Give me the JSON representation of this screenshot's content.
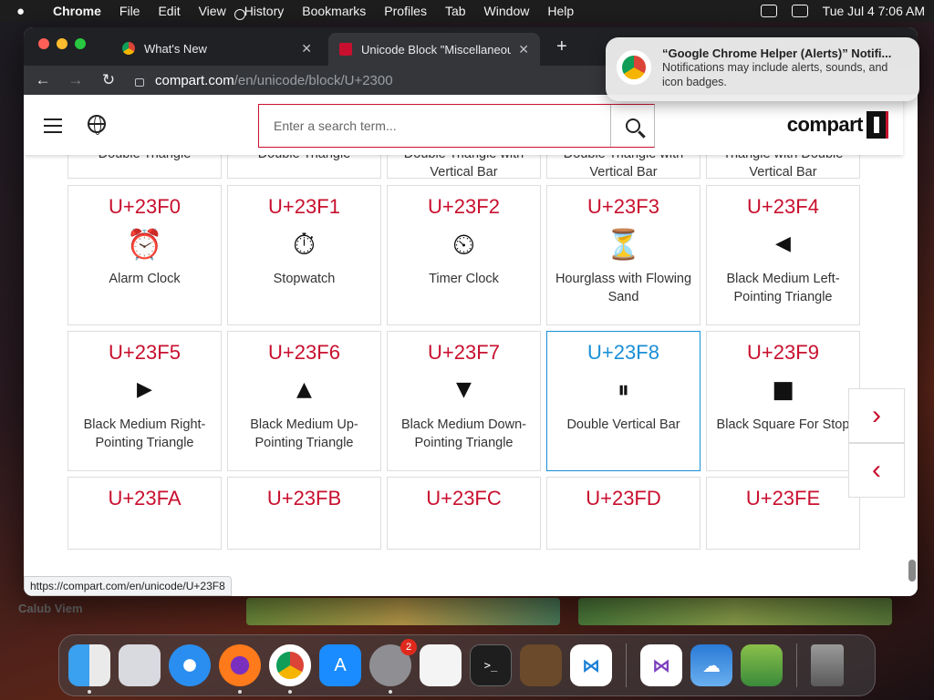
{
  "menubar": {
    "items": [
      "Chrome",
      "File",
      "Edit",
      "View",
      "History",
      "Bookmarks",
      "Profiles",
      "Tab",
      "Window",
      "Help"
    ],
    "datetime": "Tue Jul 4  7:06 AM"
  },
  "browser": {
    "tabs": [
      {
        "title": "What's New"
      },
      {
        "title": "Unicode Block \"Miscellaneous"
      }
    ],
    "url_host": "compart.com",
    "url_path": "/en/unicode/block/U+2300",
    "status_url": "https://compart.com/en/unicode/U+23F8"
  },
  "notification": {
    "title": "“Google Chrome Helper (Alerts)” Notifi...",
    "body": "Notifications may include alerts, sounds, and icon badges."
  },
  "site": {
    "search_placeholder": "Enter a search term...",
    "logo": "compart"
  },
  "partial_row": [
    {
      "name": "Black Up-Pointing Double Triangle"
    },
    {
      "name": "Black Down-Pointing Double Triangle"
    },
    {
      "name": "Black Right-Pointing Double Triangle with Vertical Bar"
    },
    {
      "name": "Black Left-Pointing Double Triangle with Vertical Bar"
    },
    {
      "name": "Black Right-Pointing Triangle with Double Vertical Bar"
    }
  ],
  "rows": [
    [
      {
        "code": "U+23F0",
        "glyph": "⏰",
        "name": "Alarm Clock"
      },
      {
        "code": "U+23F1",
        "glyph": "⏱",
        "name": "Stopwatch"
      },
      {
        "code": "U+23F2",
        "glyph": "⏲",
        "name": "Timer Clock"
      },
      {
        "code": "U+23F3",
        "glyph": "⏳",
        "name": "Hourglass with Flowing Sand"
      },
      {
        "code": "U+23F4",
        "glyph": "◀",
        "name": "Black Medium Left-Pointing Triangle"
      }
    ],
    [
      {
        "code": "U+23F5",
        "glyph": "▶",
        "name": "Black Medium Right-Pointing Triangle"
      },
      {
        "code": "U+23F6",
        "glyph": "▲",
        "name": "Black Medium Up-Pointing Triangle"
      },
      {
        "code": "U+23F7",
        "glyph": "▼",
        "name": "Black Medium Down-Pointing Triangle"
      },
      {
        "code": "U+23F8",
        "glyph": "⏸",
        "name": "Double Vertical Bar"
      },
      {
        "code": "U+23F9",
        "glyph": "■",
        "name": "Black Square For Stop"
      }
    ],
    [
      {
        "code": "U+23FA",
        "glyph": "",
        "name": ""
      },
      {
        "code": "U+23FB",
        "glyph": "",
        "name": ""
      },
      {
        "code": "U+23FC",
        "glyph": "",
        "name": ""
      },
      {
        "code": "U+23FD",
        "glyph": "",
        "name": ""
      },
      {
        "code": "U+23FE",
        "glyph": "",
        "name": ""
      }
    ]
  ],
  "desktop": {
    "partial_label": "Calub Viem"
  },
  "dock": {
    "apps": [
      "finder",
      "launchpad",
      "safari",
      "firefox",
      "chrome",
      "app-store",
      "system-settings",
      "textedit",
      "terminal",
      "garageband",
      "vscode",
      "visual-studio",
      "weather",
      "game",
      "trash"
    ],
    "settings_badge": "2"
  }
}
